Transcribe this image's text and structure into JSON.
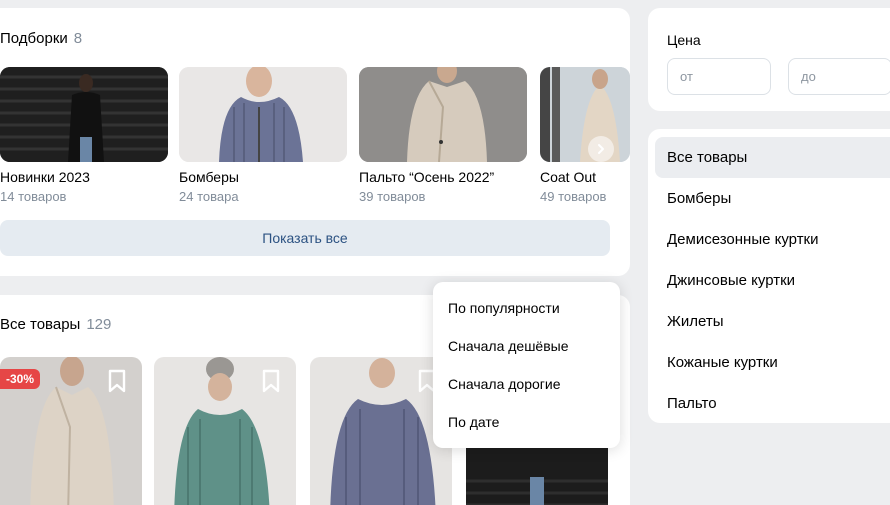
{
  "collections": {
    "title": "Подборки",
    "count": "8",
    "items": [
      {
        "name": "Новинки 2023",
        "sub": "14 товаров"
      },
      {
        "name": "Бомберы",
        "sub": "24 товара"
      },
      {
        "name": "Пальто “Осень 2022”",
        "sub": "39 товаров"
      },
      {
        "name": "Coat Out",
        "sub": "49 товаров"
      }
    ],
    "show_all": "Показать все"
  },
  "products": {
    "title": "Все товары",
    "count": "129",
    "discount": "-30%"
  },
  "sort_menu": {
    "items": [
      "По популярности",
      "Сначала дешёвые",
      "Сначала дорогие",
      "По дате"
    ]
  },
  "price": {
    "label": "Цена",
    "from_placeholder": "от",
    "to_placeholder": "до"
  },
  "categories": {
    "items": [
      "Все товары",
      "Бомберы",
      "Демисезонные куртки",
      "Джинсовые куртки",
      "Жилеты",
      "Кожаные куртки",
      "Пальто"
    ],
    "active": "Все товары"
  },
  "colors": {
    "accent_text": "#2c5282",
    "secondary_text": "#818c99",
    "discount_badge": "#e64646"
  }
}
